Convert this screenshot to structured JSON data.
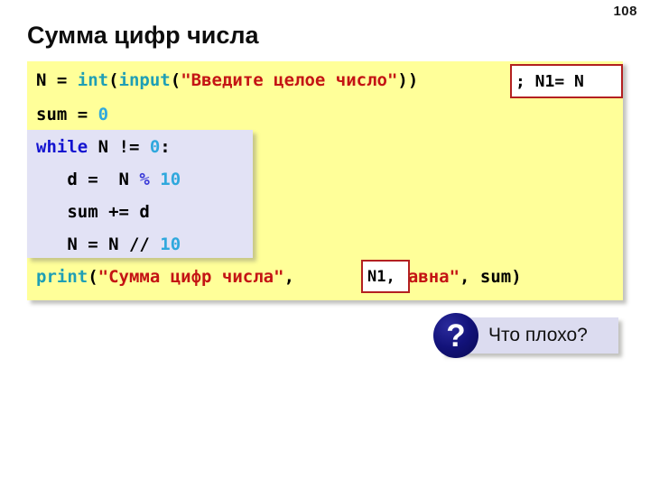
{
  "page": {
    "number": "108",
    "title": "Сумма цифр числа"
  },
  "code": {
    "language": "python",
    "lines": [
      {
        "id": "line-input",
        "tokens": [
          {
            "t": "N = ",
            "c": "plain"
          },
          {
            "t": "int",
            "c": "fn"
          },
          {
            "t": "(",
            "c": "plain"
          },
          {
            "t": "input",
            "c": "fn"
          },
          {
            "t": "(",
            "c": "plain"
          },
          {
            "t": "\"Введите целое число\"",
            "c": "str"
          },
          {
            "t": "))",
            "c": "plain"
          }
        ]
      },
      {
        "id": "line-sum-init",
        "tokens": [
          {
            "t": "sum = ",
            "c": "plain"
          },
          {
            "t": "0",
            "c": "num"
          }
        ]
      },
      {
        "id": "line-while",
        "tokens": [
          {
            "t": "while",
            "c": "kw"
          },
          {
            "t": " N != ",
            "c": "plain"
          },
          {
            "t": "0",
            "c": "num"
          },
          {
            "t": ":",
            "c": "plain"
          }
        ]
      },
      {
        "id": "line-digit",
        "tokens": [
          {
            "t": "   d =  N ",
            "c": "plain"
          },
          {
            "t": "%",
            "c": "op"
          },
          {
            "t": " ",
            "c": "plain"
          },
          {
            "t": "10",
            "c": "num"
          }
        ]
      },
      {
        "id": "line-accumulate",
        "tokens": [
          {
            "t": "   sum += d",
            "c": "plain"
          }
        ]
      },
      {
        "id": "line-divide",
        "tokens": [
          {
            "t": "   N = N // ",
            "c": "plain"
          },
          {
            "t": "10",
            "c": "num"
          }
        ]
      },
      {
        "id": "line-print",
        "tokens": [
          {
            "t": "print",
            "c": "fn"
          },
          {
            "t": "(",
            "c": "plain"
          },
          {
            "t": "\"Сумма цифр числа\"",
            "c": "str"
          },
          {
            "t": ",",
            "c": "plain"
          },
          {
            "t": "        ",
            "c": "plain"
          },
          {
            "t": "\" равна\"",
            "c": "str"
          },
          {
            "t": ", sum)",
            "c": "plain"
          }
        ]
      }
    ]
  },
  "annotations": {
    "n1_assign": "; N1= N",
    "n1_print": "N1,",
    "border_color": "#b32020"
  },
  "callout": {
    "icon": "?",
    "label": "Что плохо?"
  },
  "colors": {
    "code_background": "#ffff99",
    "highlight_background": "#e2e2f5",
    "keyword": "#1313d0",
    "function": "#1f9fb5",
    "number": "#2fa8dd",
    "string": "#c41414",
    "operator": "#3b3bd8",
    "callout_background": "#dcdcf0",
    "callout_icon": "#12127a"
  }
}
